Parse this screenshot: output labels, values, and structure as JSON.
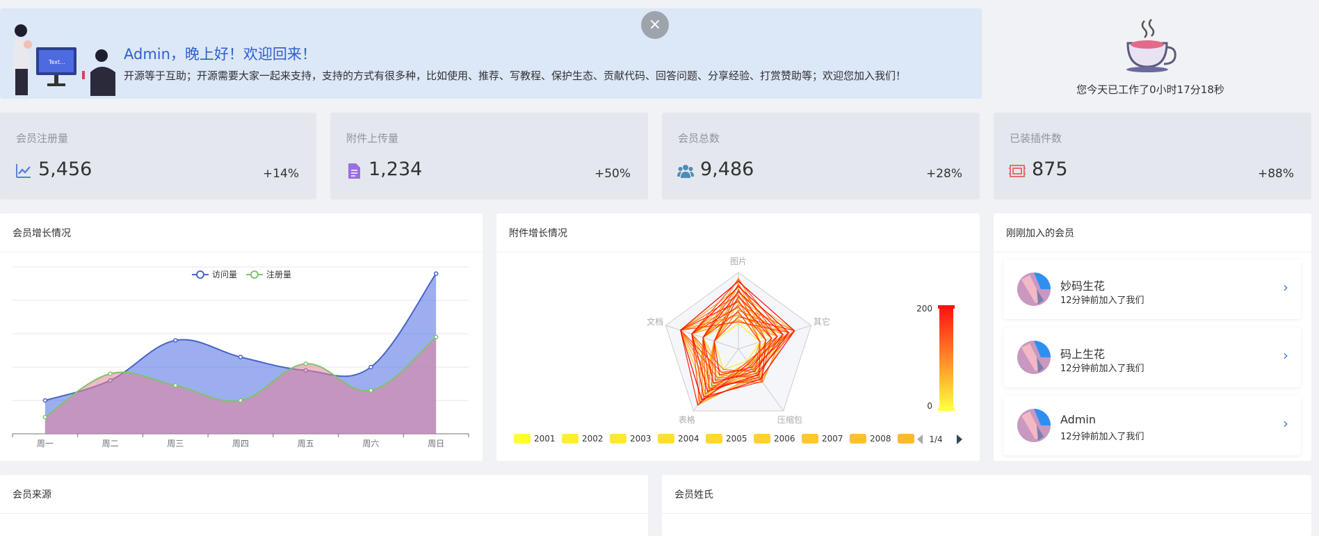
{
  "welcome": {
    "title": "Admin，晚上好！欢迎回来！",
    "desc": "开源等于互助；开源需要大家一起来支持，支持的方式有很多种，比如使用、推荐、写教程、保护生态、贡献代码、回答问题、分享经验、打赏赞助等；欢迎您加入我们！",
    "close": "×"
  },
  "work": {
    "text": "您今天已工作了0小时17分18秒"
  },
  "stats": [
    {
      "label": "会员注册量",
      "value": "5,456",
      "pct": "+14%",
      "icon": "line-chart-icon",
      "color": "#5b7ee0"
    },
    {
      "label": "附件上传量",
      "value": "1,234",
      "pct": "+50%",
      "icon": "file-icon",
      "color": "#9a6fe0"
    },
    {
      "label": "会员总数",
      "value": "9,486",
      "pct": "+28%",
      "icon": "users-icon",
      "color": "#4f8cb7"
    },
    {
      "label": "已装插件数",
      "value": "875",
      "pct": "+88%",
      "icon": "plugin-icon",
      "color": "#e07070"
    }
  ],
  "cards": {
    "growth": "会员增长情况",
    "attach": "附件增长情况",
    "newMembers": "刚刚加入的会员",
    "source": "会员来源",
    "surname": "会员姓氏"
  },
  "members": [
    {
      "name": "妙码生花",
      "time": "12分钟前加入了我们"
    },
    {
      "name": "码上生花",
      "time": "12分钟前加入了我们"
    },
    {
      "name": "Admin",
      "time": "12分钟前加入了我们"
    }
  ],
  "chart_data": [
    {
      "type": "area",
      "categories": [
        "周一",
        "周二",
        "周三",
        "周四",
        "周五",
        "周六",
        "周日"
      ],
      "series": [
        {
          "name": "访问量",
          "values": [
            100,
            160,
            280,
            230,
            190,
            200,
            480
          ],
          "color": "#4a63c8"
        },
        {
          "name": "注册量",
          "values": [
            50,
            180,
            145,
            100,
            210,
            130,
            290
          ],
          "color": "#7ec46a"
        }
      ],
      "ylim": [
        0,
        500
      ],
      "legend": "top-center"
    },
    {
      "type": "radar",
      "indicators": [
        "图片",
        "其它",
        "压缩包",
        "表格",
        "文档"
      ],
      "visualMap": {
        "max": "200",
        "min": "0"
      },
      "legend": [
        "2001",
        "2002",
        "2003",
        "2004",
        "2005",
        "2006",
        "2007",
        "2008"
      ],
      "page": "1/4"
    }
  ]
}
